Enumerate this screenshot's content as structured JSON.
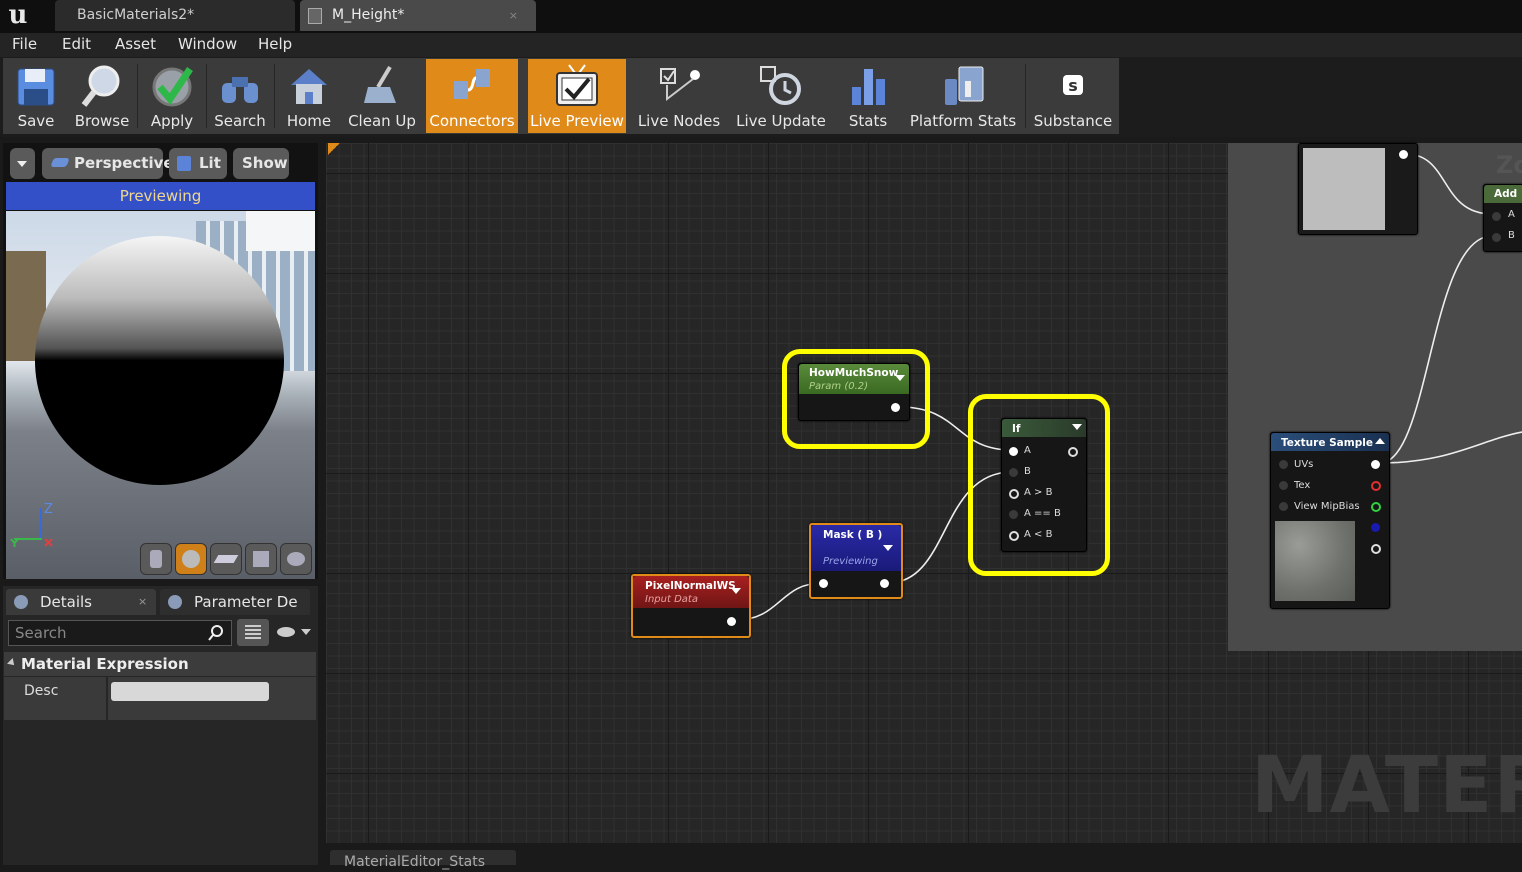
{
  "tabs": [
    {
      "label": "BasicMaterials2*",
      "close": ""
    },
    {
      "label": "M_Height*",
      "close": "×"
    }
  ],
  "menu": [
    "File",
    "Edit",
    "Asset",
    "Window",
    "Help"
  ],
  "toolbar": {
    "save": "Save",
    "browse": "Browse",
    "apply": "Apply",
    "search": "Search",
    "home": "Home",
    "cleanup": "Clean Up",
    "connectors": "Connectors",
    "live_preview": "Live Preview",
    "live_nodes": "Live Nodes",
    "live_update": "Live Update",
    "stats": "Stats",
    "platform_stats": "Platform Stats",
    "substance": "Substance"
  },
  "viewport": {
    "perspective": "Perspective",
    "lit": "Lit",
    "show": "Show",
    "previewing": "Previewing",
    "axis_z": "Z"
  },
  "details": {
    "tab1": "Details",
    "tab1_close": "×",
    "tab2": "Parameter De",
    "search_placeholder": "Search",
    "section": "Material Expression",
    "desc_label": "Desc",
    "desc_value": ""
  },
  "graph": {
    "watermark": "MATERIA",
    "zoom_label": "Zo",
    "bottom_tab": "MaterialEditor_Stats",
    "nodes": {
      "how_much_snow": {
        "title": "HowMuchSnow",
        "sub": "Param (0.2)"
      },
      "if": {
        "title": "If",
        "pins": [
          "A",
          "B",
          "A > B",
          "A == B",
          "A < B"
        ]
      },
      "mask": {
        "title": "Mask ( B )",
        "sub": "Previewing"
      },
      "pixel_normal": {
        "title": "PixelNormalWS",
        "sub": "Input Data"
      },
      "texture_sample": {
        "title": "Texture Sample",
        "pins": [
          "UVs",
          "Tex",
          "View MipBias"
        ]
      },
      "add": {
        "title": "Add",
        "pins": [
          "A",
          "B"
        ]
      }
    }
  },
  "colors": {
    "accent_active": "#e08a1a",
    "highlight": "#ffff00",
    "previewing_bar": "#3350c8"
  }
}
